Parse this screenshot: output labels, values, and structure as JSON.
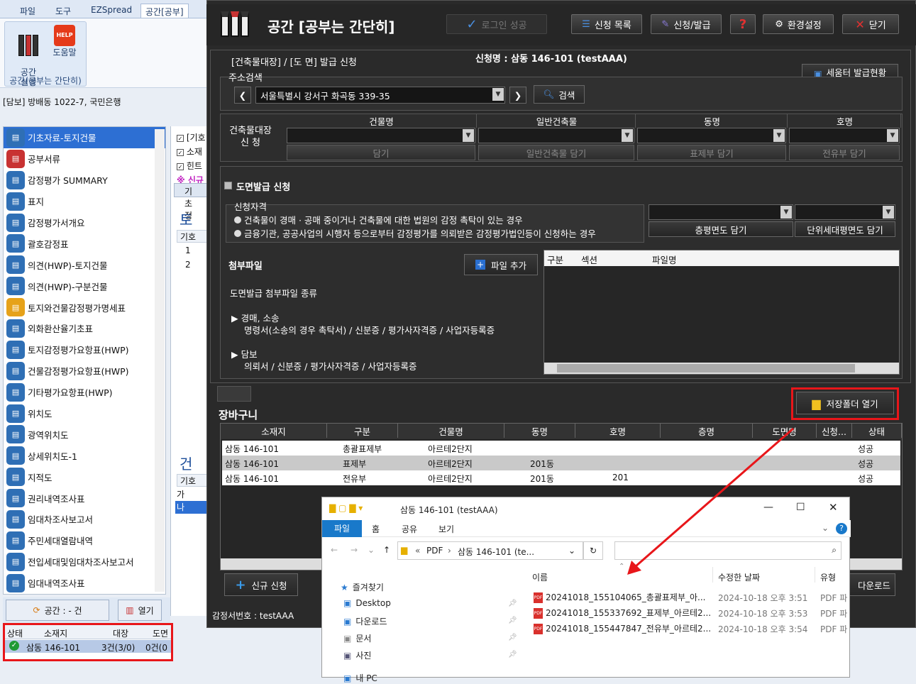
{
  "ribbon": {
    "tabs": [
      "파일",
      "도구",
      "EZSpread",
      "공간[공부]"
    ],
    "buttons": [
      {
        "label": "공간\n실행"
      },
      {
        "label": "도움말"
      }
    ],
    "group_label": "공간(공부는 간단히)"
  },
  "left": {
    "collateral": "[담보] 방배동 1022-7, 국민은행",
    "items": [
      {
        "label": "기초자료-토지건물",
        "icon": "layers-icon",
        "color": "#2f6fb5",
        "selected": true
      },
      {
        "label": "공부서류",
        "icon": "document-icon",
        "color": "#c83232"
      },
      {
        "label": "감정평가 SUMMARY",
        "icon": "summary-icon",
        "color": "#2f6fb5"
      },
      {
        "label": "표지",
        "icon": "cover-icon",
        "color": "#2f6fb5"
      },
      {
        "label": "감정평가서개요",
        "icon": "overview-icon",
        "color": "#2f6fb5"
      },
      {
        "label": "괄호감정표",
        "icon": "stamp-icon",
        "color": "#2f6fb5"
      },
      {
        "label": "의견(HWP)-토지건물",
        "icon": "layers-icon",
        "color": "#2f6fb5"
      },
      {
        "label": "의견(HWP)-구분건물",
        "icon": "layers-icon",
        "color": "#2f6fb5"
      },
      {
        "label": "토지와건물감정평가명세표",
        "icon": "book-icon",
        "color": "#e6a21a"
      },
      {
        "label": "외화환산율기초표",
        "icon": "dollar-icon",
        "color": "#2f6fb5"
      },
      {
        "label": "토지감정평가요항표(HWP)",
        "icon": "book-icon",
        "color": "#2f6fb5"
      },
      {
        "label": "건물감정평가요항표(HWP)",
        "icon": "hwp-icon",
        "color": "#2f6fb5"
      },
      {
        "label": "기타평가요항표(HWP)",
        "icon": "etc-icon",
        "color": "#2f6fb5"
      },
      {
        "label": "위치도",
        "icon": "map-icon",
        "color": "#2f6fb5"
      },
      {
        "label": "광역위치도",
        "icon": "pin-icon",
        "color": "#2f6fb5"
      },
      {
        "label": "상세위치도-1",
        "icon": "pin-icon",
        "color": "#2f6fb5"
      },
      {
        "label": "지적도",
        "icon": "globe-icon",
        "color": "#2f6fb5"
      },
      {
        "label": "권리내역조사표",
        "icon": "fingerprint-icon",
        "color": "#2f6fb5"
      },
      {
        "label": "임대차조사보고서",
        "icon": "search-doc-icon",
        "color": "#2f6fb5"
      },
      {
        "label": "주민세대열람내역",
        "icon": "people-icon",
        "color": "#2f6fb5"
      },
      {
        "label": "전입세대및임대차조사보고서",
        "icon": "report-icon",
        "color": "#2f6fb5"
      },
      {
        "label": "임대내역조사표",
        "icon": "list-icon",
        "color": "#2f6fb5"
      }
    ],
    "bottom": {
      "count_label": "공간 : - 건",
      "open_label": "열기"
    },
    "grid": {
      "headers": [
        "상태",
        "소재지",
        "대장",
        "도면"
      ],
      "row": {
        "location": "삼동 146-101",
        "ledger": "3건(3/0)",
        "drawing": "0건(0"
      }
    }
  },
  "mid": {
    "checks": [
      "[기호",
      "소재",
      "힌트"
    ],
    "note": "※ 신규",
    "tab": "기초정",
    "section1": "토",
    "col": "기호",
    "rows": [
      "1",
      "2"
    ],
    "section2": "건",
    "rows2": [
      "가",
      "나"
    ]
  },
  "main": {
    "title": "공간 [공부는 간단히]",
    "login": "로그인 성공",
    "top_buttons": [
      {
        "label": "신청 목록",
        "icon": "list-icon"
      },
      {
        "label": "신청/발급",
        "icon": "apply-icon"
      },
      {
        "label": "",
        "icon": "help-icon"
      },
      {
        "label": "환경설정",
        "icon": "gear-icon"
      },
      {
        "label": "닫기",
        "icon": "close-icon"
      }
    ],
    "crumb": "[건축물대장]  / [도 면]  발급 신청",
    "applicant": "신청명 : 삼동 146-101 (testAAA)",
    "seumter_label": "세움터 발급현황",
    "addr_label": "주소검색",
    "addr_value": "서울특별시 강서구 화곡동 339-35",
    "search_label": "검색",
    "ledger_label": "건축물대장\n신 청",
    "cols": [
      "건물명",
      "일반건축물",
      "동명",
      "호명"
    ],
    "col_buttons": [
      "담기",
      "일반건축물 담기",
      "표제부 담기",
      "전유부 담기"
    ],
    "drawing_title": "도면발급 신청",
    "qual_label": "신청자격",
    "qual_options": [
      "건축물이 경매 · 공매 중이거나 건축물에 대한 법원의 감정 촉탁이 있는 경우",
      "금융기관, 공공사업의 시행자 등으로부터 감정평가를 의뢰받은 감정평가법인등이 신청하는 경우"
    ],
    "draw_buttons": [
      "층평면도 담기",
      "단위세대평면도 담기"
    ],
    "attach_label": "첨부파일",
    "add_file": "파일 추가",
    "file_headers": [
      "구분",
      "섹션",
      "파일명"
    ],
    "attach_kinds": "도면발급 첨부파일 종류",
    "kind1_title": "경매, 소송",
    "kind1_detail": "명령서(소송의 경우 촉탁서) / 신분증 / 평가사자격증 / 사업자등록증",
    "kind2_title": "담보",
    "kind2_detail": "의뢰서 / 신분증 / 평가사자격증 / 사업자등록증",
    "basket_label": "장바구니",
    "open_folder": "저장폴더 열기",
    "basket_headers": [
      "소재지",
      "구분",
      "건물명",
      "동명",
      "호명",
      "층명",
      "도면명",
      "신청...",
      "상태"
    ],
    "basket_rows": [
      [
        "삼동 146-101",
        "총괄표제부",
        "아르테2단지",
        "",
        "",
        "",
        "",
        "",
        "성공"
      ],
      [
        "삼동 146-101",
        "표제부",
        "아르테2단지",
        "201동",
        "",
        "",
        "",
        "",
        "성공"
      ],
      [
        "삼동 146-101",
        "전유부",
        "아르테2단지",
        "201동",
        "201",
        "",
        "",
        "",
        "성공"
      ]
    ],
    "new_apply": "신규 신청",
    "download": "다운로드",
    "status": "감정서번호 : testAAA"
  },
  "explorer": {
    "title": "삼동 146-101 (testAAA)",
    "tabs": [
      "파일",
      "홈",
      "공유",
      "보기"
    ],
    "path": [
      "PDF",
      "삼동 146-101 (te..."
    ],
    "nav": [
      {
        "label": "즐겨찾기",
        "icon": "star-icon"
      },
      {
        "label": "Desktop",
        "icon": "desktop-icon"
      },
      {
        "label": "다운로드",
        "icon": "download-icon"
      },
      {
        "label": "문서",
        "icon": "document-icon"
      },
      {
        "label": "사진",
        "icon": "picture-icon"
      },
      {
        "label": "내 PC",
        "icon": "pc-icon"
      }
    ],
    "headers": [
      "이름",
      "수정한 날짜",
      "유형"
    ],
    "files": [
      {
        "name": "20241018_155104065_총괄표제부_아...",
        "date": "2024-10-18 오후 3:51",
        "type": "PDF 파"
      },
      {
        "name": "20241018_155337692_표제부_아르테2...",
        "date": "2024-10-18 오후 3:53",
        "type": "PDF 파"
      },
      {
        "name": "20241018_155447847_전유부_아르테2...",
        "date": "2024-10-18 오후 3:54",
        "type": "PDF 파"
      }
    ]
  },
  "colors": {
    "highlight": "#e8161a",
    "selection": "#2d6fd3",
    "dark": "#2a2a2a"
  }
}
